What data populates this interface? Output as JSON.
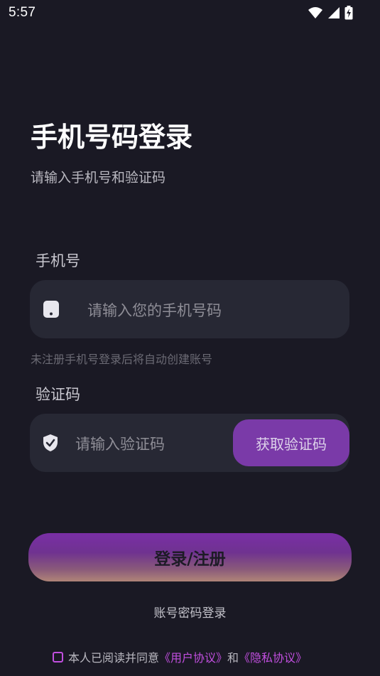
{
  "status_bar": {
    "time": "5:57"
  },
  "header": {
    "title": "手机号码登录",
    "subtitle": "请输入手机号和验证码"
  },
  "phone": {
    "label": "手机号",
    "placeholder": "请输入您的手机号码",
    "hint": "未注册手机号登录后将自动创建账号"
  },
  "code": {
    "label": "验证码",
    "placeholder": "请输入验证码",
    "get_code_label": "获取验证码"
  },
  "login_button_label": "登录/注册",
  "password_login_label": "账号密码登录",
  "agreement": {
    "prefix": "本人已阅读并同意",
    "user_agreement": "《用户协议》",
    "connector": "和",
    "privacy_policy": "《隐私协议》"
  },
  "colors": {
    "background": "#1a1924",
    "input_background": "#272834",
    "accent": "#7a3aa8",
    "link": "#c24fe0"
  }
}
